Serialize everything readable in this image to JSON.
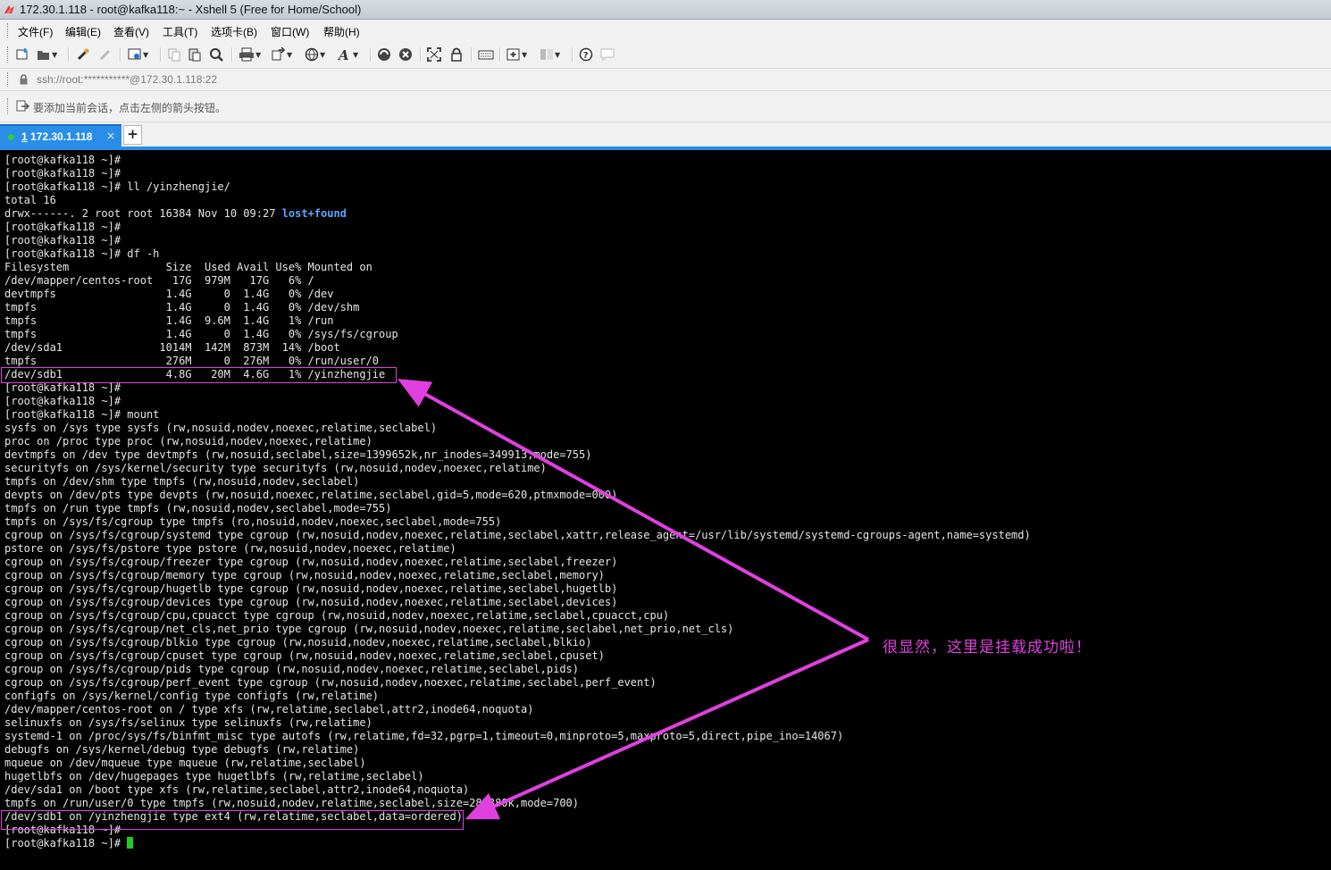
{
  "window": {
    "title": "172.30.1.118 - root@kafka118:~ - Xshell 5 (Free for Home/School)"
  },
  "menu": [
    {
      "label": "文件(F)"
    },
    {
      "label": "编辑(E)"
    },
    {
      "label": "查看(V)"
    },
    {
      "label": "工具(T)"
    },
    {
      "label": "选项卡(B)"
    },
    {
      "label": "窗口(W)"
    },
    {
      "label": "帮助(H)"
    }
  ],
  "toolbar_icons": [
    "new-session-icon",
    "open-folder-icon",
    "reconnect-icon",
    "disconnect-icon",
    "properties-icon",
    "copy-icon",
    "paste-icon",
    "find-icon",
    "print-icon",
    "transfer-icon",
    "globe-icon",
    "font-icon",
    "xftp-icon",
    "xmanager-icon",
    "fullscreen-icon",
    "lock-icon",
    "keyboard-icon",
    "add-compose-icon",
    "layout-icon",
    "help-icon",
    "chat-icon"
  ],
  "address": {
    "value": "ssh://root:***********@172.30.1.118:22"
  },
  "hint": {
    "text": "要添加当前会话，点击左侧的箭头按钮。"
  },
  "tabs": [
    {
      "number": "1",
      "title": "172.30.1.118",
      "close": "×"
    }
  ],
  "new_tab": "+",
  "terminal": {
    "lines": [
      "[root@kafka118 ~]#",
      "[root@kafka118 ~]#",
      "[root@kafka118 ~]# ll /yinzhengjie/",
      "total 16",
      "drwx------. 2 root root 16384 Nov 10 09:27 ",
      "[root@kafka118 ~]#",
      "[root@kafka118 ~]#",
      "[root@kafka118 ~]# df -h",
      "Filesystem               Size  Used Avail Use% Mounted on",
      "/dev/mapper/centos-root   17G  979M   17G   6% /",
      "devtmpfs                 1.4G     0  1.4G   0% /dev",
      "tmpfs                    1.4G     0  1.4G   0% /dev/shm",
      "tmpfs                    1.4G  9.6M  1.4G   1% /run",
      "tmpfs                    1.4G     0  1.4G   0% /sys/fs/cgroup",
      "/dev/sda1               1014M  142M  873M  14% /boot",
      "tmpfs                    276M     0  276M   0% /run/user/0",
      "/dev/sdb1                4.8G   20M  4.6G   1% /yinzhengjie",
      "[root@kafka118 ~]#",
      "[root@kafka118 ~]#",
      "[root@kafka118 ~]# mount",
      "sysfs on /sys type sysfs (rw,nosuid,nodev,noexec,relatime,seclabel)",
      "proc on /proc type proc (rw,nosuid,nodev,noexec,relatime)",
      "devtmpfs on /dev type devtmpfs (rw,nosuid,seclabel,size=1399652k,nr_inodes=349913,mode=755)",
      "securityfs on /sys/kernel/security type securityfs (rw,nosuid,nodev,noexec,relatime)",
      "tmpfs on /dev/shm type tmpfs (rw,nosuid,nodev,seclabel)",
      "devpts on /dev/pts type devpts (rw,nosuid,noexec,relatime,seclabel,gid=5,mode=620,ptmxmode=000)",
      "tmpfs on /run type tmpfs (rw,nosuid,nodev,seclabel,mode=755)",
      "tmpfs on /sys/fs/cgroup type tmpfs (ro,nosuid,nodev,noexec,seclabel,mode=755)",
      "cgroup on /sys/fs/cgroup/systemd type cgroup (rw,nosuid,nodev,noexec,relatime,seclabel,xattr,release_agent=/usr/lib/systemd/systemd-cgroups-agent,name=systemd)",
      "pstore on /sys/fs/pstore type pstore (rw,nosuid,nodev,noexec,relatime)",
      "cgroup on /sys/fs/cgroup/freezer type cgroup (rw,nosuid,nodev,noexec,relatime,seclabel,freezer)",
      "cgroup on /sys/fs/cgroup/memory type cgroup (rw,nosuid,nodev,noexec,relatime,seclabel,memory)",
      "cgroup on /sys/fs/cgroup/hugetlb type cgroup (rw,nosuid,nodev,noexec,relatime,seclabel,hugetlb)",
      "cgroup on /sys/fs/cgroup/devices type cgroup (rw,nosuid,nodev,noexec,relatime,seclabel,devices)",
      "cgroup on /sys/fs/cgroup/cpu,cpuacct type cgroup (rw,nosuid,nodev,noexec,relatime,seclabel,cpuacct,cpu)",
      "cgroup on /sys/fs/cgroup/net_cls,net_prio type cgroup (rw,nosuid,nodev,noexec,relatime,seclabel,net_prio,net_cls)",
      "cgroup on /sys/fs/cgroup/blkio type cgroup (rw,nosuid,nodev,noexec,relatime,seclabel,blkio)",
      "cgroup on /sys/fs/cgroup/cpuset type cgroup (rw,nosuid,nodev,noexec,relatime,seclabel,cpuset)",
      "cgroup on /sys/fs/cgroup/pids type cgroup (rw,nosuid,nodev,noexec,relatime,seclabel,pids)",
      "cgroup on /sys/fs/cgroup/perf_event type cgroup (rw,nosuid,nodev,noexec,relatime,seclabel,perf_event)",
      "configfs on /sys/kernel/config type configfs (rw,relatime)",
      "/dev/mapper/centos-root on / type xfs (rw,relatime,seclabel,attr2,inode64,noquota)",
      "selinuxfs on /sys/fs/selinux type selinuxfs (rw,relatime)",
      "systemd-1 on /proc/sys/fs/binfmt_misc type autofs (rw,relatime,fd=32,pgrp=1,timeout=0,minproto=5,maxproto=5,direct,pipe_ino=14067)",
      "debugfs on /sys/kernel/debug type debugfs (rw,relatime)",
      "mqueue on /dev/mqueue type mqueue (rw,relatime,seclabel)",
      "hugetlbfs on /dev/hugepages type hugetlbfs (rw,relatime,seclabel)",
      "/dev/sda1 on /boot type xfs (rw,relatime,seclabel,attr2,inode64,noquota)",
      "tmpfs on /run/user/0 type tmpfs (rw,nosuid,nodev,relatime,seclabel,size=282380k,mode=700)",
      "/dev/sdb1 on /yinzhengjie type ext4 (rw,relatime,seclabel,data=ordered)",
      "[root@kafka118 ~]#",
      "[root@kafka118 ~]# "
    ],
    "lost_found": "lost+found"
  },
  "annotation": {
    "text": "很显然，这里是挂载成功啦！",
    "color": "#e040e0"
  },
  "colors": {
    "tab_active": "#2a8ee8",
    "cursor": "#22cc22",
    "directory": "#5aa7ff",
    "annotation": "#e040e0"
  }
}
